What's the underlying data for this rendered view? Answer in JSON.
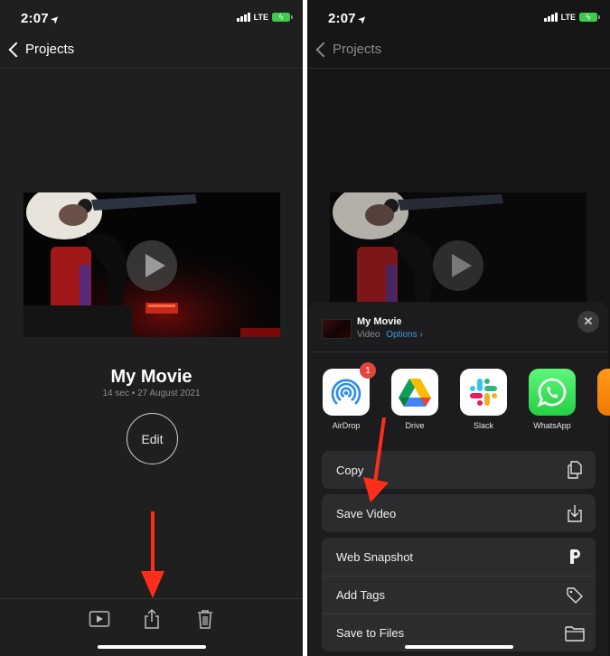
{
  "left_screen": {
    "status_bar": {
      "time": "2:07",
      "network": "LTE",
      "battery_state": "charging"
    },
    "nav": {
      "back_label": "Projects"
    },
    "movie": {
      "title": "My Movie",
      "meta": "14 sec • 27 August 2021"
    },
    "edit_label": "Edit",
    "toolbar": {
      "icons": [
        "play-icon",
        "share-icon",
        "trash-icon"
      ]
    },
    "annotation": {
      "type": "arrow",
      "points_to": "share-icon",
      "color": "#ff2d1a"
    }
  },
  "right_screen": {
    "status_bar": {
      "time": "2:07",
      "network": "LTE",
      "battery_state": "charging"
    },
    "nav": {
      "back_label": "Projects"
    },
    "share_sheet": {
      "title": "My Movie",
      "type_label": "Video",
      "options_label": "Options",
      "apps": [
        {
          "label": "AirDrop",
          "icon": "airdrop-icon",
          "badge": "1"
        },
        {
          "label": "Drive",
          "icon": "google-drive-icon"
        },
        {
          "label": "Slack",
          "icon": "slack-icon"
        },
        {
          "label": "WhatsApp",
          "icon": "whatsapp-icon"
        },
        {
          "label": "",
          "icon": "partial-app-icon"
        }
      ],
      "actions_group_1": [
        {
          "label": "Copy",
          "icon": "copy-icon"
        }
      ],
      "actions_group_2": [
        {
          "label": "Save Video",
          "icon": "save-download-icon"
        }
      ],
      "actions_group_3": [
        {
          "label": "Web Snapshot",
          "icon": "p-logo-icon"
        },
        {
          "label": "Add Tags",
          "icon": "tag-icon"
        },
        {
          "label": "Save to Files",
          "icon": "folder-icon"
        }
      ]
    },
    "annotation": {
      "type": "arrow",
      "points_to": "Save Video",
      "color": "#ff2d1a"
    }
  },
  "colors": {
    "accent_link": "#3d9ee0",
    "annotation_red": "#ff2d1a",
    "badge_red": "#e5443b",
    "battery_green": "#3fcb4e"
  }
}
